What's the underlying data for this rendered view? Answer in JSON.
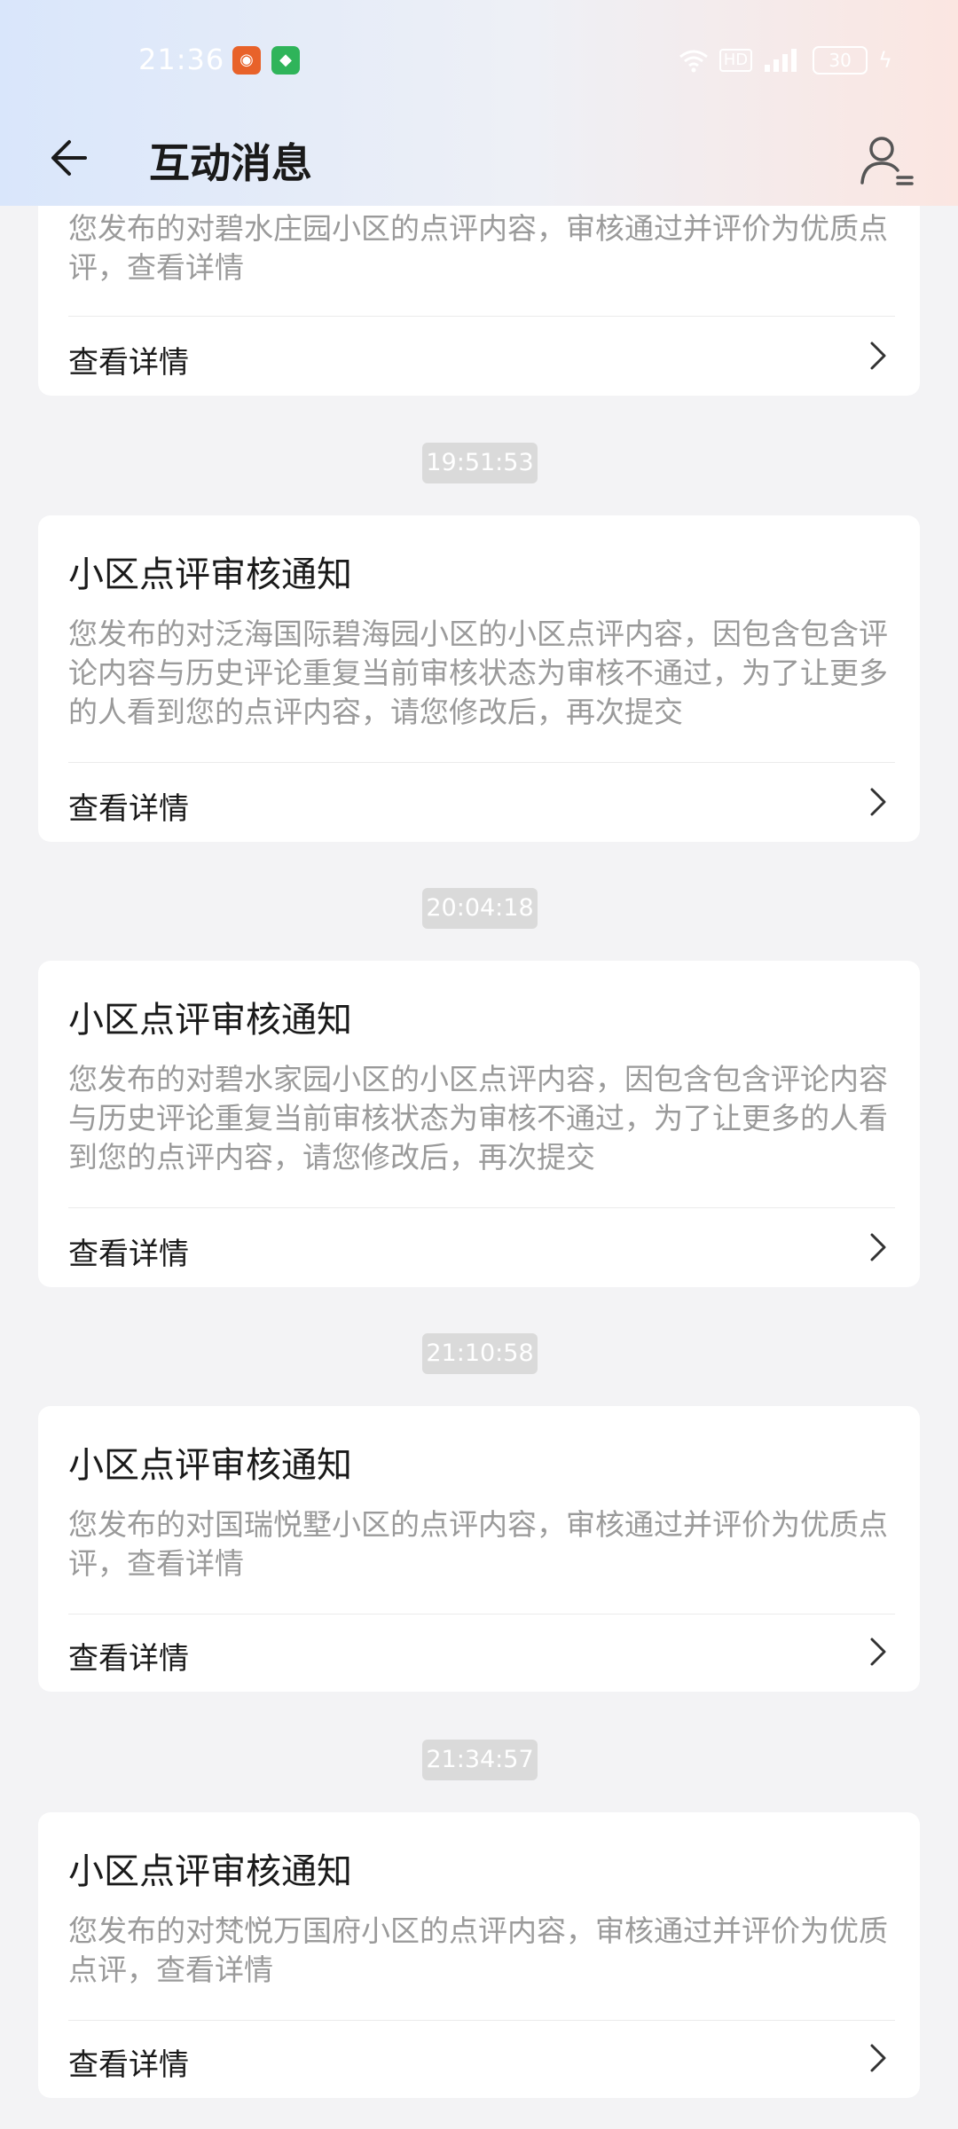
{
  "status_bar": {
    "time": "21:36",
    "battery": "30",
    "app_badges": [
      "app-notification-icon",
      "app-notification-icon"
    ],
    "icons": [
      "wifi-icon",
      "hd-icon",
      "signal-icon",
      "battery-icon",
      "charging-icon"
    ]
  },
  "header": {
    "title": "互动消息",
    "back_icon": "back-arrow-icon",
    "profile_icon": "user-icon"
  },
  "colors": {
    "header_gradient_left": "#d9e6fb",
    "header_gradient_right": "#fbe6e1",
    "timestamp_bg": "#dadada"
  },
  "messages": [
    {
      "title": "",
      "desc": "您发布的对碧水庄园小区的点评内容，审核通过并评价为优质点评，查看详情",
      "link": "查看详情"
    },
    {
      "timestamp": "19:51:53",
      "title": "小区点评审核通知",
      "desc": "您发布的对泛海国际碧海园小区的小区点评内容，因包含包含评论内容与历史评论重复当前审核状态为审核不通过，为了让更多的人看到您的点评内容，请您修改后，再次提交",
      "link": "查看详情"
    },
    {
      "timestamp": "20:04:18",
      "title": "小区点评审核通知",
      "desc": "您发布的对碧水家园小区的小区点评内容，因包含包含评论内容与历史评论重复当前审核状态为审核不通过，为了让更多的人看到您的点评内容，请您修改后，再次提交",
      "link": "查看详情"
    },
    {
      "timestamp": "21:10:58",
      "title": "小区点评审核通知",
      "desc": "您发布的对国瑞悦墅小区的点评内容，审核通过并评价为优质点评，查看详情",
      "link": "查看详情"
    },
    {
      "timestamp": "21:34:57",
      "title": "小区点评审核通知",
      "desc": "您发布的对梵悦万国府小区的点评内容，审核通过并评价为优质点评，查看详情",
      "link": "查看详情"
    }
  ]
}
